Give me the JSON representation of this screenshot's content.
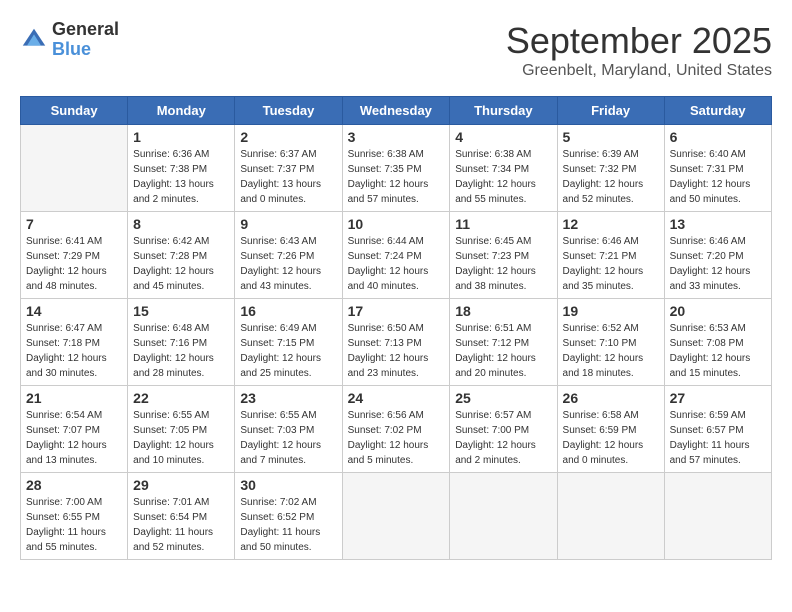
{
  "header": {
    "logo": {
      "general": "General",
      "blue": "Blue"
    },
    "title": "September 2025",
    "location": "Greenbelt, Maryland, United States"
  },
  "weekdays": [
    "Sunday",
    "Monday",
    "Tuesday",
    "Wednesday",
    "Thursday",
    "Friday",
    "Saturday"
  ],
  "weeks": [
    [
      {
        "day": null
      },
      {
        "day": 1,
        "sunrise": "6:36 AM",
        "sunset": "7:38 PM",
        "daylight": "13 hours and 2 minutes."
      },
      {
        "day": 2,
        "sunrise": "6:37 AM",
        "sunset": "7:37 PM",
        "daylight": "13 hours and 0 minutes."
      },
      {
        "day": 3,
        "sunrise": "6:38 AM",
        "sunset": "7:35 PM",
        "daylight": "12 hours and 57 minutes."
      },
      {
        "day": 4,
        "sunrise": "6:38 AM",
        "sunset": "7:34 PM",
        "daylight": "12 hours and 55 minutes.",
        "highlight": true
      },
      {
        "day": 5,
        "sunrise": "6:39 AM",
        "sunset": "7:32 PM",
        "daylight": "12 hours and 52 minutes."
      },
      {
        "day": 6,
        "sunrise": "6:40 AM",
        "sunset": "7:31 PM",
        "daylight": "12 hours and 50 minutes."
      }
    ],
    [
      {
        "day": 7,
        "sunrise": "6:41 AM",
        "sunset": "7:29 PM",
        "daylight": "12 hours and 48 minutes."
      },
      {
        "day": 8,
        "sunrise": "6:42 AM",
        "sunset": "7:28 PM",
        "daylight": "12 hours and 45 minutes."
      },
      {
        "day": 9,
        "sunrise": "6:43 AM",
        "sunset": "7:26 PM",
        "daylight": "12 hours and 43 minutes."
      },
      {
        "day": 10,
        "sunrise": "6:44 AM",
        "sunset": "7:24 PM",
        "daylight": "12 hours and 40 minutes."
      },
      {
        "day": 11,
        "sunrise": "6:45 AM",
        "sunset": "7:23 PM",
        "daylight": "12 hours and 38 minutes."
      },
      {
        "day": 12,
        "sunrise": "6:46 AM",
        "sunset": "7:21 PM",
        "daylight": "12 hours and 35 minutes."
      },
      {
        "day": 13,
        "sunrise": "6:46 AM",
        "sunset": "7:20 PM",
        "daylight": "12 hours and 33 minutes."
      }
    ],
    [
      {
        "day": 14,
        "sunrise": "6:47 AM",
        "sunset": "7:18 PM",
        "daylight": "12 hours and 30 minutes."
      },
      {
        "day": 15,
        "sunrise": "6:48 AM",
        "sunset": "7:16 PM",
        "daylight": "12 hours and 28 minutes."
      },
      {
        "day": 16,
        "sunrise": "6:49 AM",
        "sunset": "7:15 PM",
        "daylight": "12 hours and 25 minutes."
      },
      {
        "day": 17,
        "sunrise": "6:50 AM",
        "sunset": "7:13 PM",
        "daylight": "12 hours and 23 minutes."
      },
      {
        "day": 18,
        "sunrise": "6:51 AM",
        "sunset": "7:12 PM",
        "daylight": "12 hours and 20 minutes."
      },
      {
        "day": 19,
        "sunrise": "6:52 AM",
        "sunset": "7:10 PM",
        "daylight": "12 hours and 18 minutes."
      },
      {
        "day": 20,
        "sunrise": "6:53 AM",
        "sunset": "7:08 PM",
        "daylight": "12 hours and 15 minutes."
      }
    ],
    [
      {
        "day": 21,
        "sunrise": "6:54 AM",
        "sunset": "7:07 PM",
        "daylight": "12 hours and 13 minutes."
      },
      {
        "day": 22,
        "sunrise": "6:55 AM",
        "sunset": "7:05 PM",
        "daylight": "12 hours and 10 minutes."
      },
      {
        "day": 23,
        "sunrise": "6:55 AM",
        "sunset": "7:03 PM",
        "daylight": "12 hours and 7 minutes."
      },
      {
        "day": 24,
        "sunrise": "6:56 AM",
        "sunset": "7:02 PM",
        "daylight": "12 hours and 5 minutes."
      },
      {
        "day": 25,
        "sunrise": "6:57 AM",
        "sunset": "7:00 PM",
        "daylight": "12 hours and 2 minutes."
      },
      {
        "day": 26,
        "sunrise": "6:58 AM",
        "sunset": "6:59 PM",
        "daylight": "12 hours and 0 minutes."
      },
      {
        "day": 27,
        "sunrise": "6:59 AM",
        "sunset": "6:57 PM",
        "daylight": "11 hours and 57 minutes."
      }
    ],
    [
      {
        "day": 28,
        "sunrise": "7:00 AM",
        "sunset": "6:55 PM",
        "daylight": "11 hours and 55 minutes."
      },
      {
        "day": 29,
        "sunrise": "7:01 AM",
        "sunset": "6:54 PM",
        "daylight": "11 hours and 52 minutes."
      },
      {
        "day": 30,
        "sunrise": "7:02 AM",
        "sunset": "6:52 PM",
        "daylight": "11 hours and 50 minutes."
      },
      {
        "day": null
      },
      {
        "day": null
      },
      {
        "day": null
      },
      {
        "day": null
      }
    ]
  ]
}
